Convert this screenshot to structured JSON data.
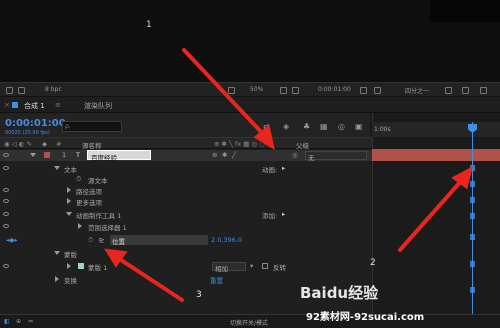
{
  "viewer": {
    "marker": "1"
  },
  "viewer_toolbar": {
    "bpc": "8 bpc",
    "zoom": "50%",
    "timecode": "0:00:01:00",
    "resolution": "四分之一"
  },
  "tabs": [
    {
      "label": "合成 1"
    },
    {
      "label": "渲染队列"
    }
  ],
  "timecode": {
    "current": "0:00:01:00",
    "fps": "00025 (25.00 fps)"
  },
  "search": {
    "placeholder": "ρ."
  },
  "columns": {
    "source": "源名称",
    "parent": "父级"
  },
  "layer": {
    "index": "1",
    "type_icon": "T",
    "name": "百度经验",
    "parent": "无"
  },
  "props": {
    "text": "文本",
    "animate": "动画:",
    "source_text": "源文本",
    "path_options": "路径选项",
    "more_options": "更多选项",
    "animator": "动画制作工具 1",
    "add": "添加:",
    "range_selector": "范围选择器 1",
    "position_label": "位置",
    "position_value": "2.0,396.0",
    "mask": "蒙版",
    "mask1": "蒙版 1",
    "mask_mode": "相加",
    "invert": "反转",
    "transform": "变换",
    "reset": "重置"
  },
  "bottom": {
    "switches": "切换开关/模式"
  },
  "ruler": {
    "start": "1:00s"
  },
  "annotations": {
    "n2": "2",
    "n3": "3"
  },
  "watermark": {
    "brand": "Baidu经验",
    "site": "92素材网-92sucai.com"
  },
  "colors": {
    "accent": "#3f8fe5",
    "arrow": "#e8261f",
    "layer_bar": "#b25148"
  }
}
